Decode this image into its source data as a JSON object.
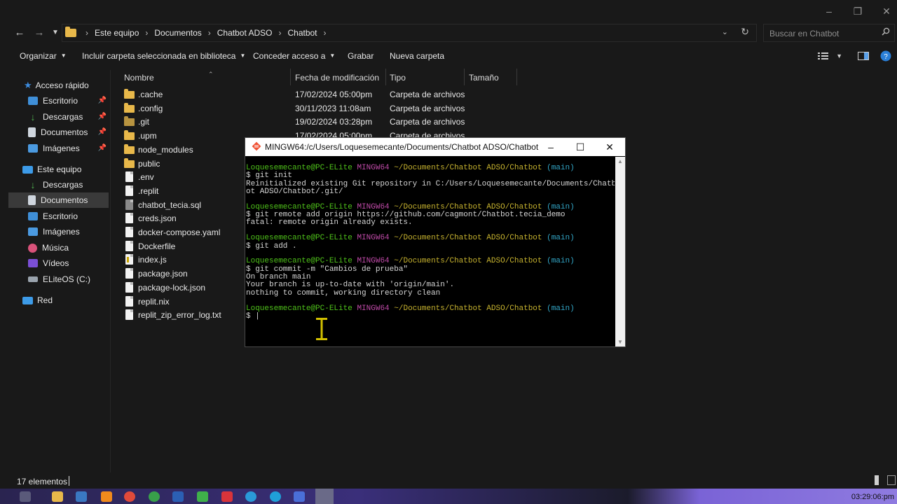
{
  "breadcrumb": [
    "Este equipo",
    "Documentos",
    "Chatbot ADSO",
    "Chatbot"
  ],
  "search": {
    "placeholder": "Buscar en Chatbot"
  },
  "commandbar": {
    "organize": "Organizar",
    "include": "Incluir carpeta seleccionada en biblioteca",
    "share": "Conceder acceso a",
    "burn": "Grabar",
    "new_folder": "Nueva carpeta"
  },
  "nav": {
    "quick_access": "Acceso rápido",
    "quick": [
      "Escritorio",
      "Descargas",
      "Documentos",
      "Imágenes"
    ],
    "this_pc": "Este equipo",
    "pc": [
      "Descargas",
      "Documentos",
      "Escritorio",
      "Imágenes",
      "Música",
      "Vídeos",
      "ELiteOS (C:)"
    ],
    "network": "Red"
  },
  "columns": {
    "name": "Nombre",
    "modified": "Fecha de modificación",
    "type": "Tipo",
    "size": "Tamaño"
  },
  "files": [
    {
      "name": ".cache",
      "date": "17/02/2024 05:00pm",
      "type": "Carpeta de archivos",
      "kind": "folder"
    },
    {
      "name": ".config",
      "date": "30/11/2023 11:08am",
      "type": "Carpeta de archivos",
      "kind": "folder"
    },
    {
      "name": ".git",
      "date": "19/02/2024 03:28pm",
      "type": "Carpeta de archivos",
      "kind": "folder-dim"
    },
    {
      "name": ".upm",
      "date": "17/02/2024 05:00pm",
      "type": "Carpeta de archivos",
      "kind": "folder"
    },
    {
      "name": "node_modules",
      "date": "",
      "type": "",
      "kind": "folder"
    },
    {
      "name": "public",
      "date": "",
      "type": "",
      "kind": "folder"
    },
    {
      "name": ".env",
      "date": "",
      "type": "",
      "kind": "file"
    },
    {
      "name": ".replit",
      "date": "",
      "type": "",
      "kind": "file"
    },
    {
      "name": "chatbot_tecia.sql",
      "date": "",
      "type": "",
      "kind": "file-dark"
    },
    {
      "name": "creds.json",
      "date": "",
      "type": "",
      "kind": "file"
    },
    {
      "name": "docker-compose.yaml",
      "date": "",
      "type": "",
      "kind": "file"
    },
    {
      "name": "Dockerfile",
      "date": "",
      "type": "",
      "kind": "file"
    },
    {
      "name": "index.js",
      "date": "",
      "type": "",
      "kind": "file-js"
    },
    {
      "name": "package.json",
      "date": "",
      "type": "",
      "kind": "file"
    },
    {
      "name": "package-lock.json",
      "date": "",
      "type": "",
      "kind": "file"
    },
    {
      "name": "replit.nix",
      "date": "",
      "type": "",
      "kind": "file"
    },
    {
      "name": "replit_zip_error_log.txt",
      "date": "",
      "type": "",
      "kind": "file"
    }
  ],
  "status": {
    "count": "17 elementos"
  },
  "terminal": {
    "title": "MINGW64:/c/Users/Loquesemecante/Documents/Chatbot ADSO/Chatbot",
    "prompt": {
      "user": "Loquesemecante@PC-ELite",
      "env": "MINGW64",
      "path": "~/Documents/Chatbot ADSO/Chatbot",
      "branch": "(main)"
    },
    "blocks": [
      {
        "cmd": "$ git init",
        "out": [
          "Reinitialized existing Git repository in C:/Users/Loquesemecante/Documents/Chatb",
          "ot ADSO/Chatbot/.git/"
        ]
      },
      {
        "cmd": "$ git remote add origin https://github.com/cagmont/Chatbot.tecia_demo",
        "out": [
          "fatal: remote origin already exists."
        ]
      },
      {
        "cmd": "$ git add .",
        "out": []
      },
      {
        "cmd": "$ git commit -m \"Cambios de prueba\"",
        "out": [
          "On branch main",
          "Your branch is up-to-date with 'origin/main'.",
          "nothing to commit, working directory clean"
        ]
      },
      {
        "cmd": "$ |",
        "out": []
      }
    ]
  },
  "taskbar": {
    "time": "03:29:06:pm"
  },
  "colors": {
    "folder": "#e8b84a",
    "prompt_user": "#4fc21a",
    "prompt_env": "#c04aa8",
    "prompt_path": "#c7b32f",
    "prompt_branch": "#33a8c9"
  }
}
